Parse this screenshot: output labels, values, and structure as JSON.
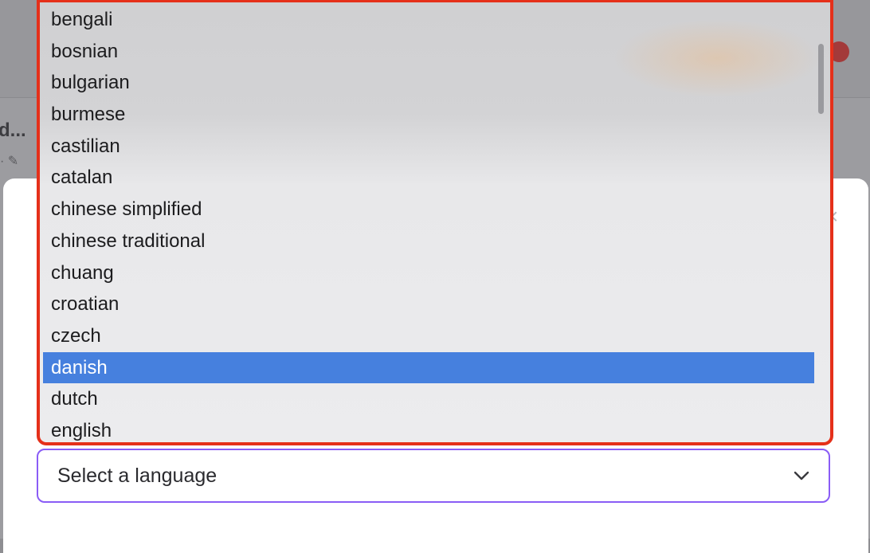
{
  "backdrop": {
    "title_fragment": "d...",
    "meta_fragment": "· ✎"
  },
  "modal": {
    "close_glyph": "×"
  },
  "language_select": {
    "current_value": "Select a language",
    "options": [
      "bengali",
      "bosnian",
      "bulgarian",
      "burmese",
      "castilian",
      "catalan",
      "chinese simplified",
      "chinese traditional",
      "chuang",
      "croatian",
      "czech",
      "danish",
      "dutch",
      "english"
    ],
    "highlighted_option": "danish"
  },
  "colors": {
    "focus_border": "#8a5cf6",
    "dropdown_outline": "#e5301a",
    "highlight": "#4680de"
  }
}
